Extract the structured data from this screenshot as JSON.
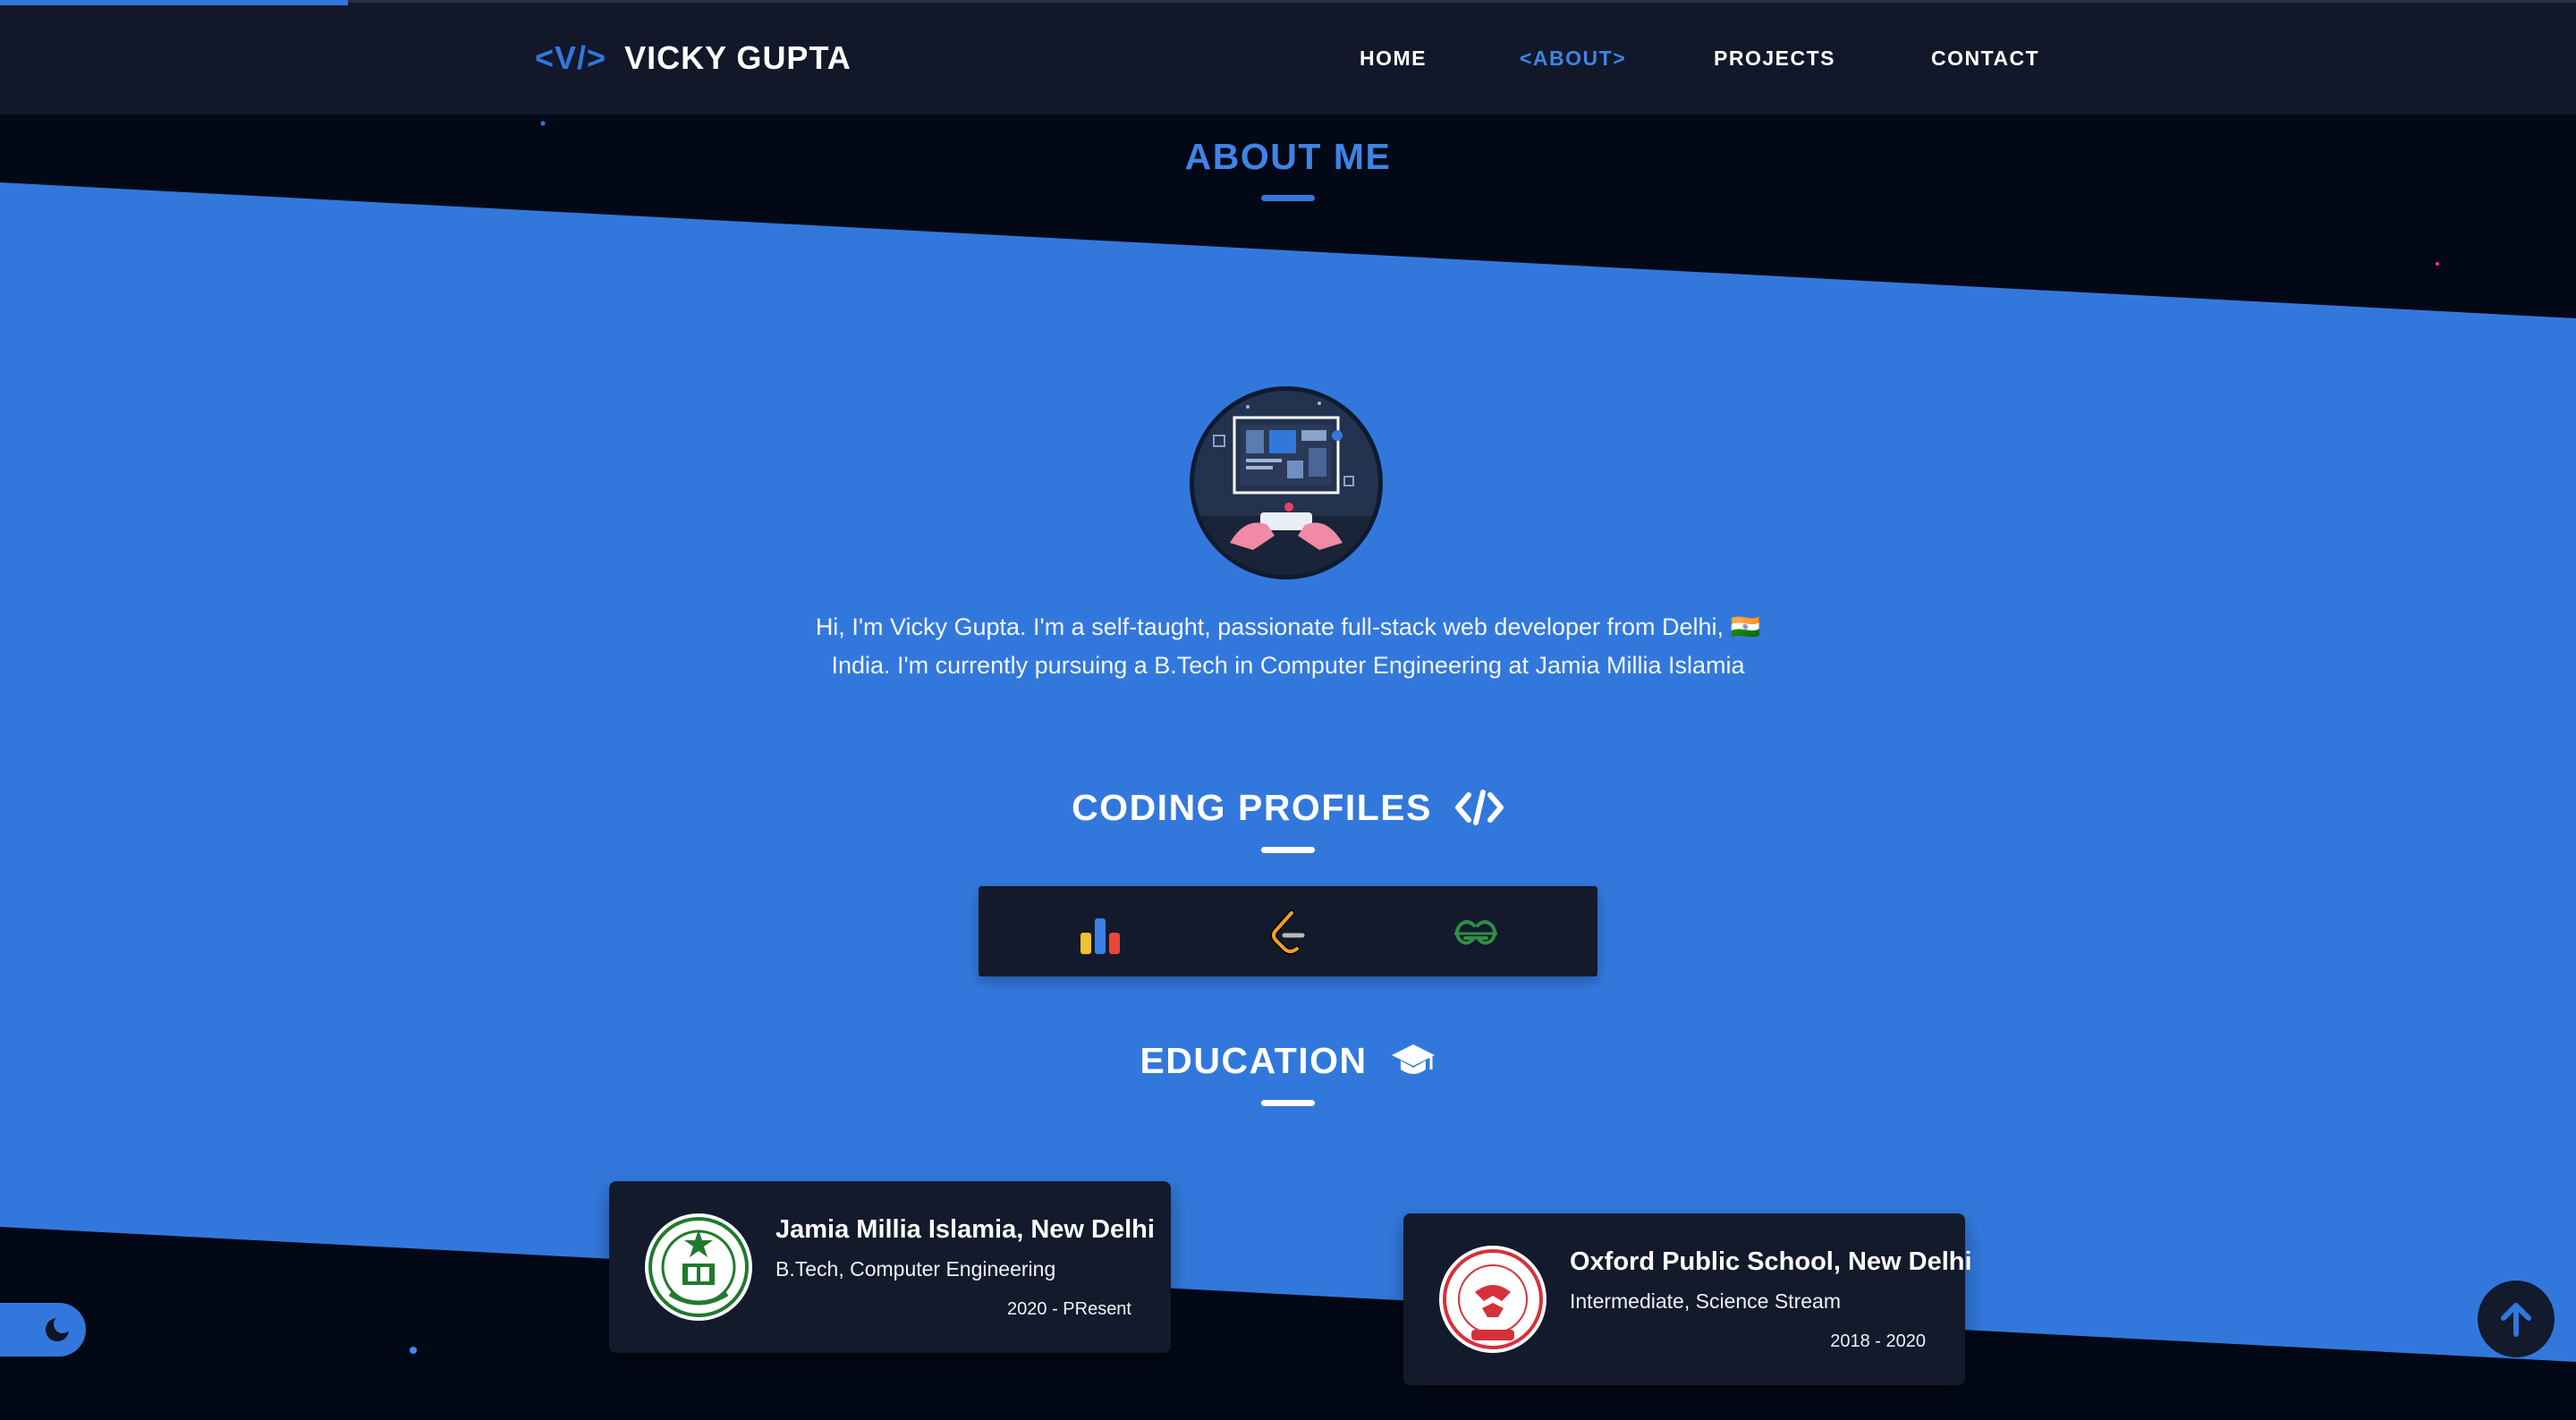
{
  "header": {
    "logo_mark": "<V/>",
    "logo_name": "VICKY GUPTA",
    "nav": [
      "HOME",
      "<ABOUT>",
      "PROJECTS",
      "CONTACT"
    ],
    "active_nav": "<ABOUT>"
  },
  "scroll_progress": 0.135,
  "about": {
    "title": "ABOUT ME",
    "bio": "Hi, I'm Vicky Gupta. I'm a self-taught, passionate full-stack web developer from Delhi, 🇮🇳India. I'm currently pursuing a B.Tech in Computer Engineering at Jamia Millia Islamia"
  },
  "coding_profiles": {
    "title": "CODING PROFILES",
    "title_icon": "code-icon",
    "items": [
      "codechef-icon",
      "leetcode-icon",
      "geeksforgeeks-icon"
    ]
  },
  "education": {
    "title": "EDUCATION",
    "title_icon": "graduation-cap-icon",
    "items": [
      {
        "name": "Jamia Millia Islamia, New Delhi",
        "degree": "B.Tech, Computer Engineering",
        "years": "2020 - PResent",
        "logo_icon": "jmi-logo-icon"
      },
      {
        "name": "Oxford Public School, New Delhi",
        "degree": "Intermediate, Science Stream",
        "years": "2018 - 2020",
        "logo_icon": "ops-logo-icon"
      }
    ]
  },
  "controls": {
    "theme_toggle_icon": "moon-icon",
    "scroll_top_icon": "arrow-up-icon"
  },
  "colors": {
    "accent": "#3278dc",
    "navbar": "#121829",
    "background_dark": "#030817",
    "card": "#131a2b",
    "text": "#ffffff"
  }
}
